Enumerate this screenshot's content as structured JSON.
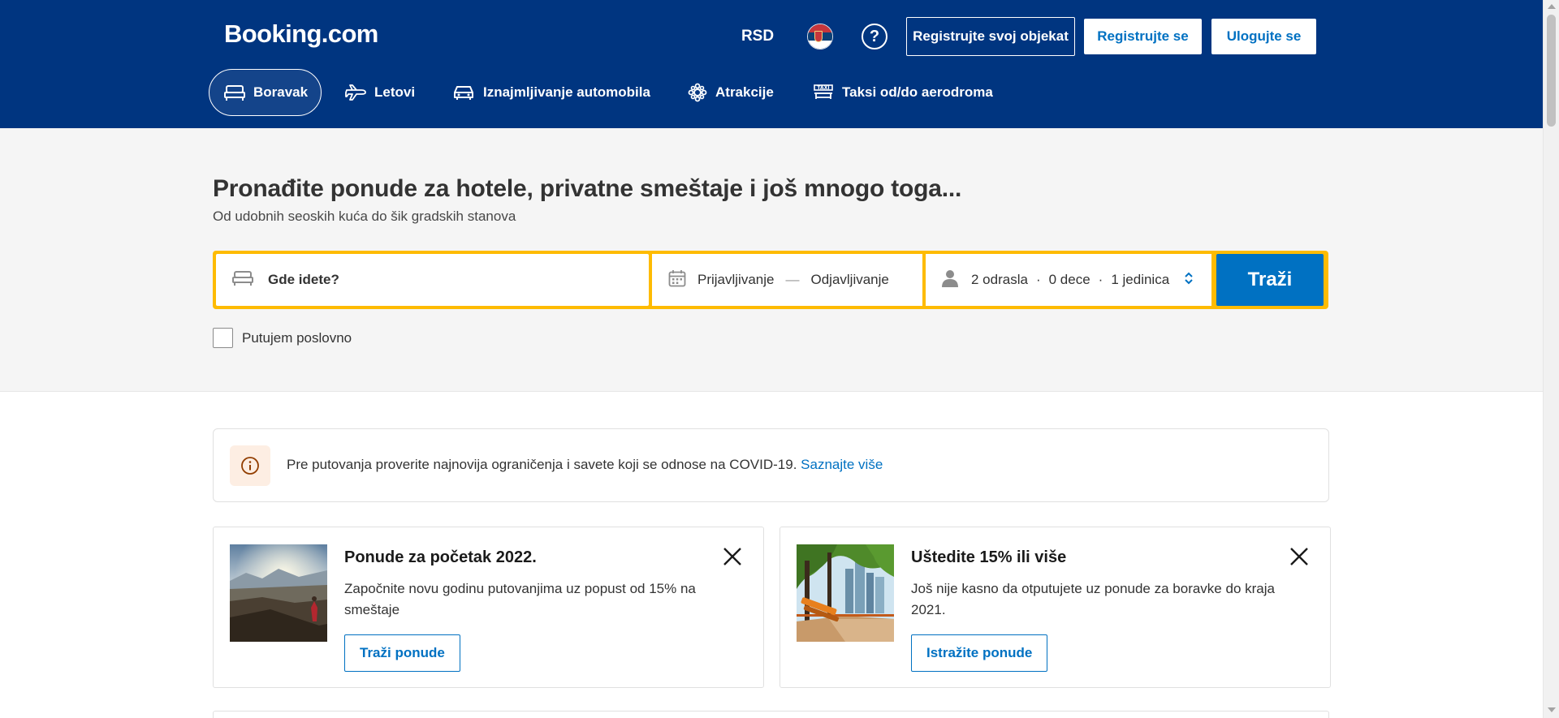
{
  "header": {
    "logo": "Booking.com",
    "currency": "RSD",
    "language_icon": "serbia-flag-icon",
    "help_symbol": "?",
    "list_property_label": "Registrujte svoj objekat",
    "register_label": "Registrujte se",
    "login_label": "Ulogujte se",
    "background_color": "#003580"
  },
  "nav": {
    "items": [
      {
        "label": "Boravak",
        "icon": "bed-icon",
        "active": true
      },
      {
        "label": "Letovi",
        "icon": "plane-icon",
        "active": false
      },
      {
        "label": "Iznajmljivanje automobila",
        "icon": "car-icon",
        "active": false
      },
      {
        "label": "Atrakcije",
        "icon": "attractions-icon",
        "active": false
      },
      {
        "label": "Taksi od/do aerodroma",
        "icon": "taxi-icon",
        "active": false
      }
    ]
  },
  "hero": {
    "title": "Pronađite ponude za hotele, privatne smeštaje i još mnogo toga...",
    "subtitle": "Od udobnih seoskih kuća do šik gradskih stanova"
  },
  "search": {
    "destination_placeholder": "Gde idete?",
    "checkin_label": "Prijavljivanje",
    "date_separator": "—",
    "checkout_label": "Odjavljivanje",
    "adults": "2 odrasla",
    "children": "0 dece",
    "rooms": "1 jedinica",
    "separator": "·",
    "submit_label": "Traži",
    "business_checkbox_label": "Putujem poslovno",
    "business_checked": false,
    "accent_color": "#febb02",
    "button_color": "#0071c2"
  },
  "covid_banner": {
    "text": "Pre putovanja proverite najnovija ograničenja i savete koji se odnose na COVID-19.",
    "link_label": "Saznajte više"
  },
  "promos": [
    {
      "title": "Ponude za početak 2022.",
      "description": "Započnite novu godinu putovanjima uz popust od 15% na smeštaje",
      "button_label": "Traži ponude"
    },
    {
      "title": "Uštedite 15% ili više",
      "description": "Još nije kasno da otputujete uz ponude za boravke do kraja 2021.",
      "button_label": "Istražite ponude"
    }
  ]
}
